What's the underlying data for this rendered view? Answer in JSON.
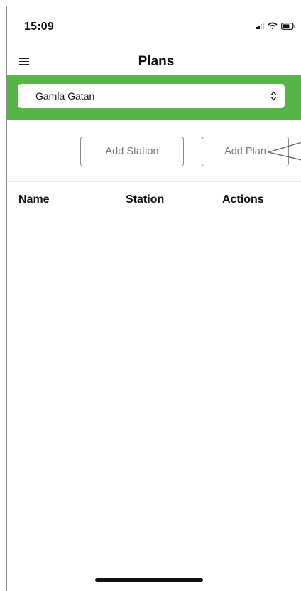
{
  "status_bar": {
    "time": "15:09",
    "icons": [
      "signal-icon",
      "wifi-icon",
      "battery-icon"
    ]
  },
  "header": {
    "title": "Plans",
    "menu_icon": "hamburger-menu-icon"
  },
  "station_selector": {
    "value": "Gamla Gatan",
    "icon": "select-arrows-icon",
    "bar_color": "#57b548"
  },
  "toolbar": {
    "add_station_label": "Add Station",
    "add_plan_label": "Add Plan"
  },
  "table": {
    "columns": [
      "Name",
      "Station",
      "Actions"
    ],
    "rows": []
  }
}
